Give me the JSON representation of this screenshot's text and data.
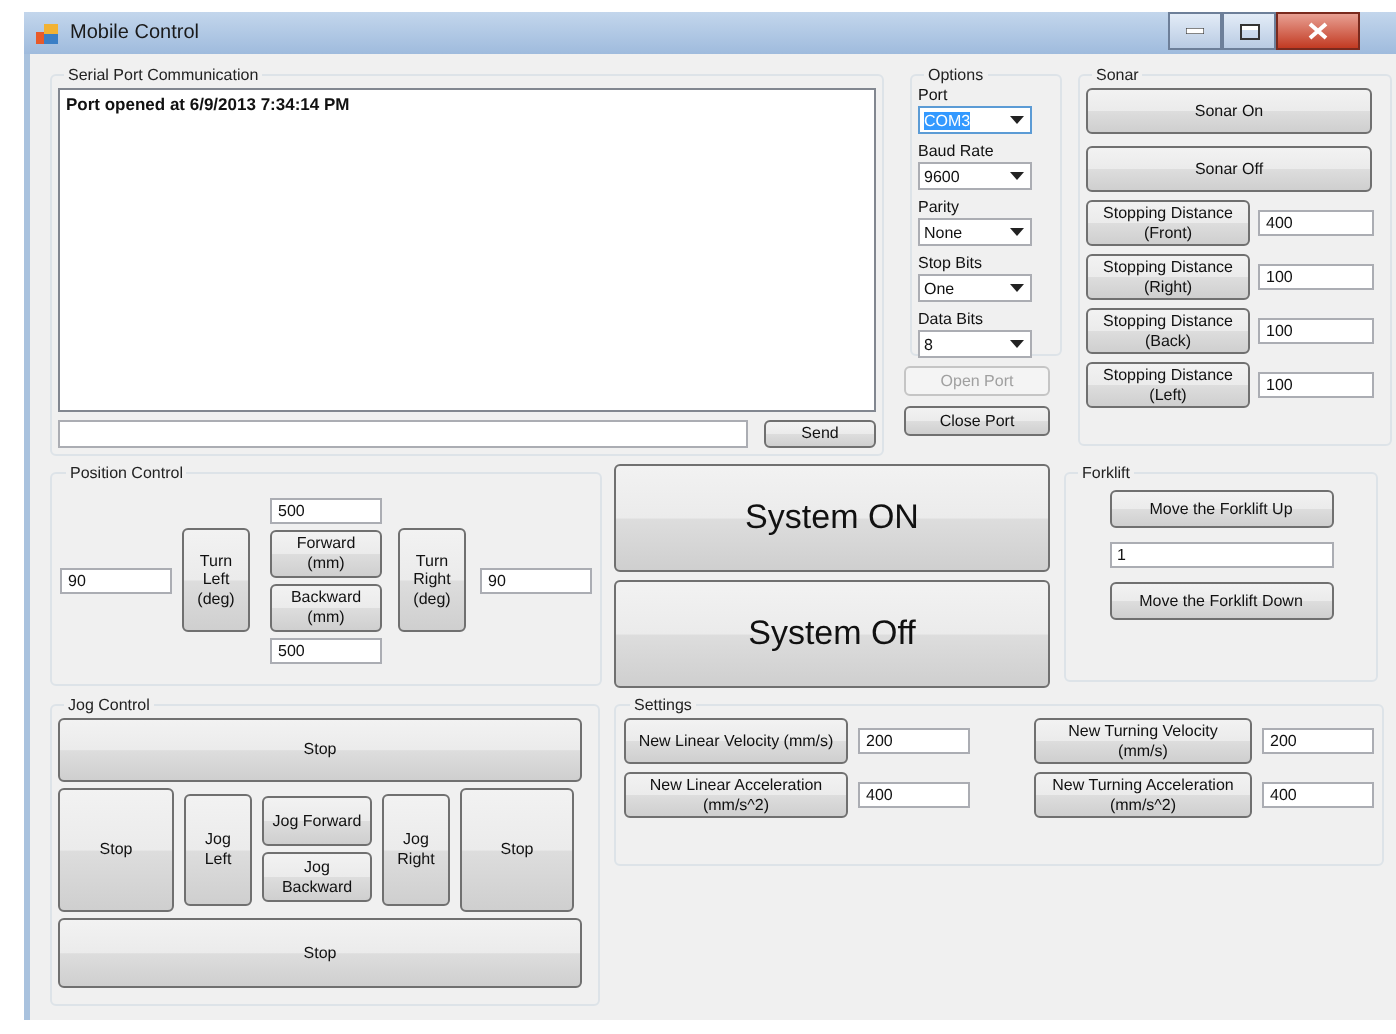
{
  "window": {
    "title": "Mobile Control"
  },
  "serial_port": {
    "title": "Serial Port Communication",
    "log": "Port opened at 6/9/2013 7:34:14 PM",
    "send_button": "Send"
  },
  "options": {
    "title": "Options",
    "fields": [
      {
        "label": "Port",
        "value": "COM3",
        "focused": true
      },
      {
        "label": "Baud Rate",
        "value": "9600",
        "focused": false
      },
      {
        "label": "Parity",
        "value": "None",
        "focused": false
      },
      {
        "label": "Stop Bits",
        "value": "One",
        "focused": false
      },
      {
        "label": "Data Bits",
        "value": "8",
        "focused": false
      }
    ],
    "buttons": [
      {
        "label": "Open Port",
        "disabled": true
      },
      {
        "label": "Close Port",
        "disabled": false
      }
    ]
  },
  "sonar": {
    "title": "Sonar",
    "buttons": [
      "Sonar On",
      "Sonar Off"
    ],
    "distances": [
      {
        "label": "Stopping Distance\n(Front)",
        "value": "400"
      },
      {
        "label": "Stopping Distance\n(Right)",
        "value": "100"
      },
      {
        "label": "Stopping Distance\n(Back)",
        "value": "100"
      },
      {
        "label": "Stopping Distance\n(Left)",
        "value": "100"
      }
    ]
  },
  "position_control": {
    "title": "Position Control",
    "forward_value": "500",
    "backward_value": "500",
    "left_value": "90",
    "right_value": "90",
    "turn_left": "Turn\nLeft\n(deg)",
    "forward": "Forward\n(mm)",
    "backward": "Backward\n(mm)",
    "turn_right": "Turn\nRight\n(deg)"
  },
  "system_buttons": [
    "System ON",
    "System Off"
  ],
  "forklift": {
    "title": "Forklift",
    "up_button": "Move the Forklift Up",
    "value": "1",
    "down_button": "Move the Forklift Down"
  },
  "jog_control": {
    "title": "Jog Control",
    "stop_top": "Stop",
    "stop_left": "Stop",
    "jog_left": "Jog\nLeft",
    "jog_forward": "Jog Forward",
    "jog_backward": "Jog\nBackward",
    "jog_right": "Jog\nRight",
    "stop_right": "Stop",
    "stop_bottom": "Stop"
  },
  "settings": {
    "title": "Settings",
    "items": [
      {
        "label": "New Linear Velocity (mm/s)",
        "value": "200"
      },
      {
        "label": "New Linear Acceleration\n(mm/s^2)",
        "value": "400"
      },
      {
        "label": "New Turning Velocity\n(mm/s)",
        "value": "200"
      },
      {
        "label": "New Turning Acceleration\n(mm/s^2)",
        "value": "400"
      }
    ]
  }
}
